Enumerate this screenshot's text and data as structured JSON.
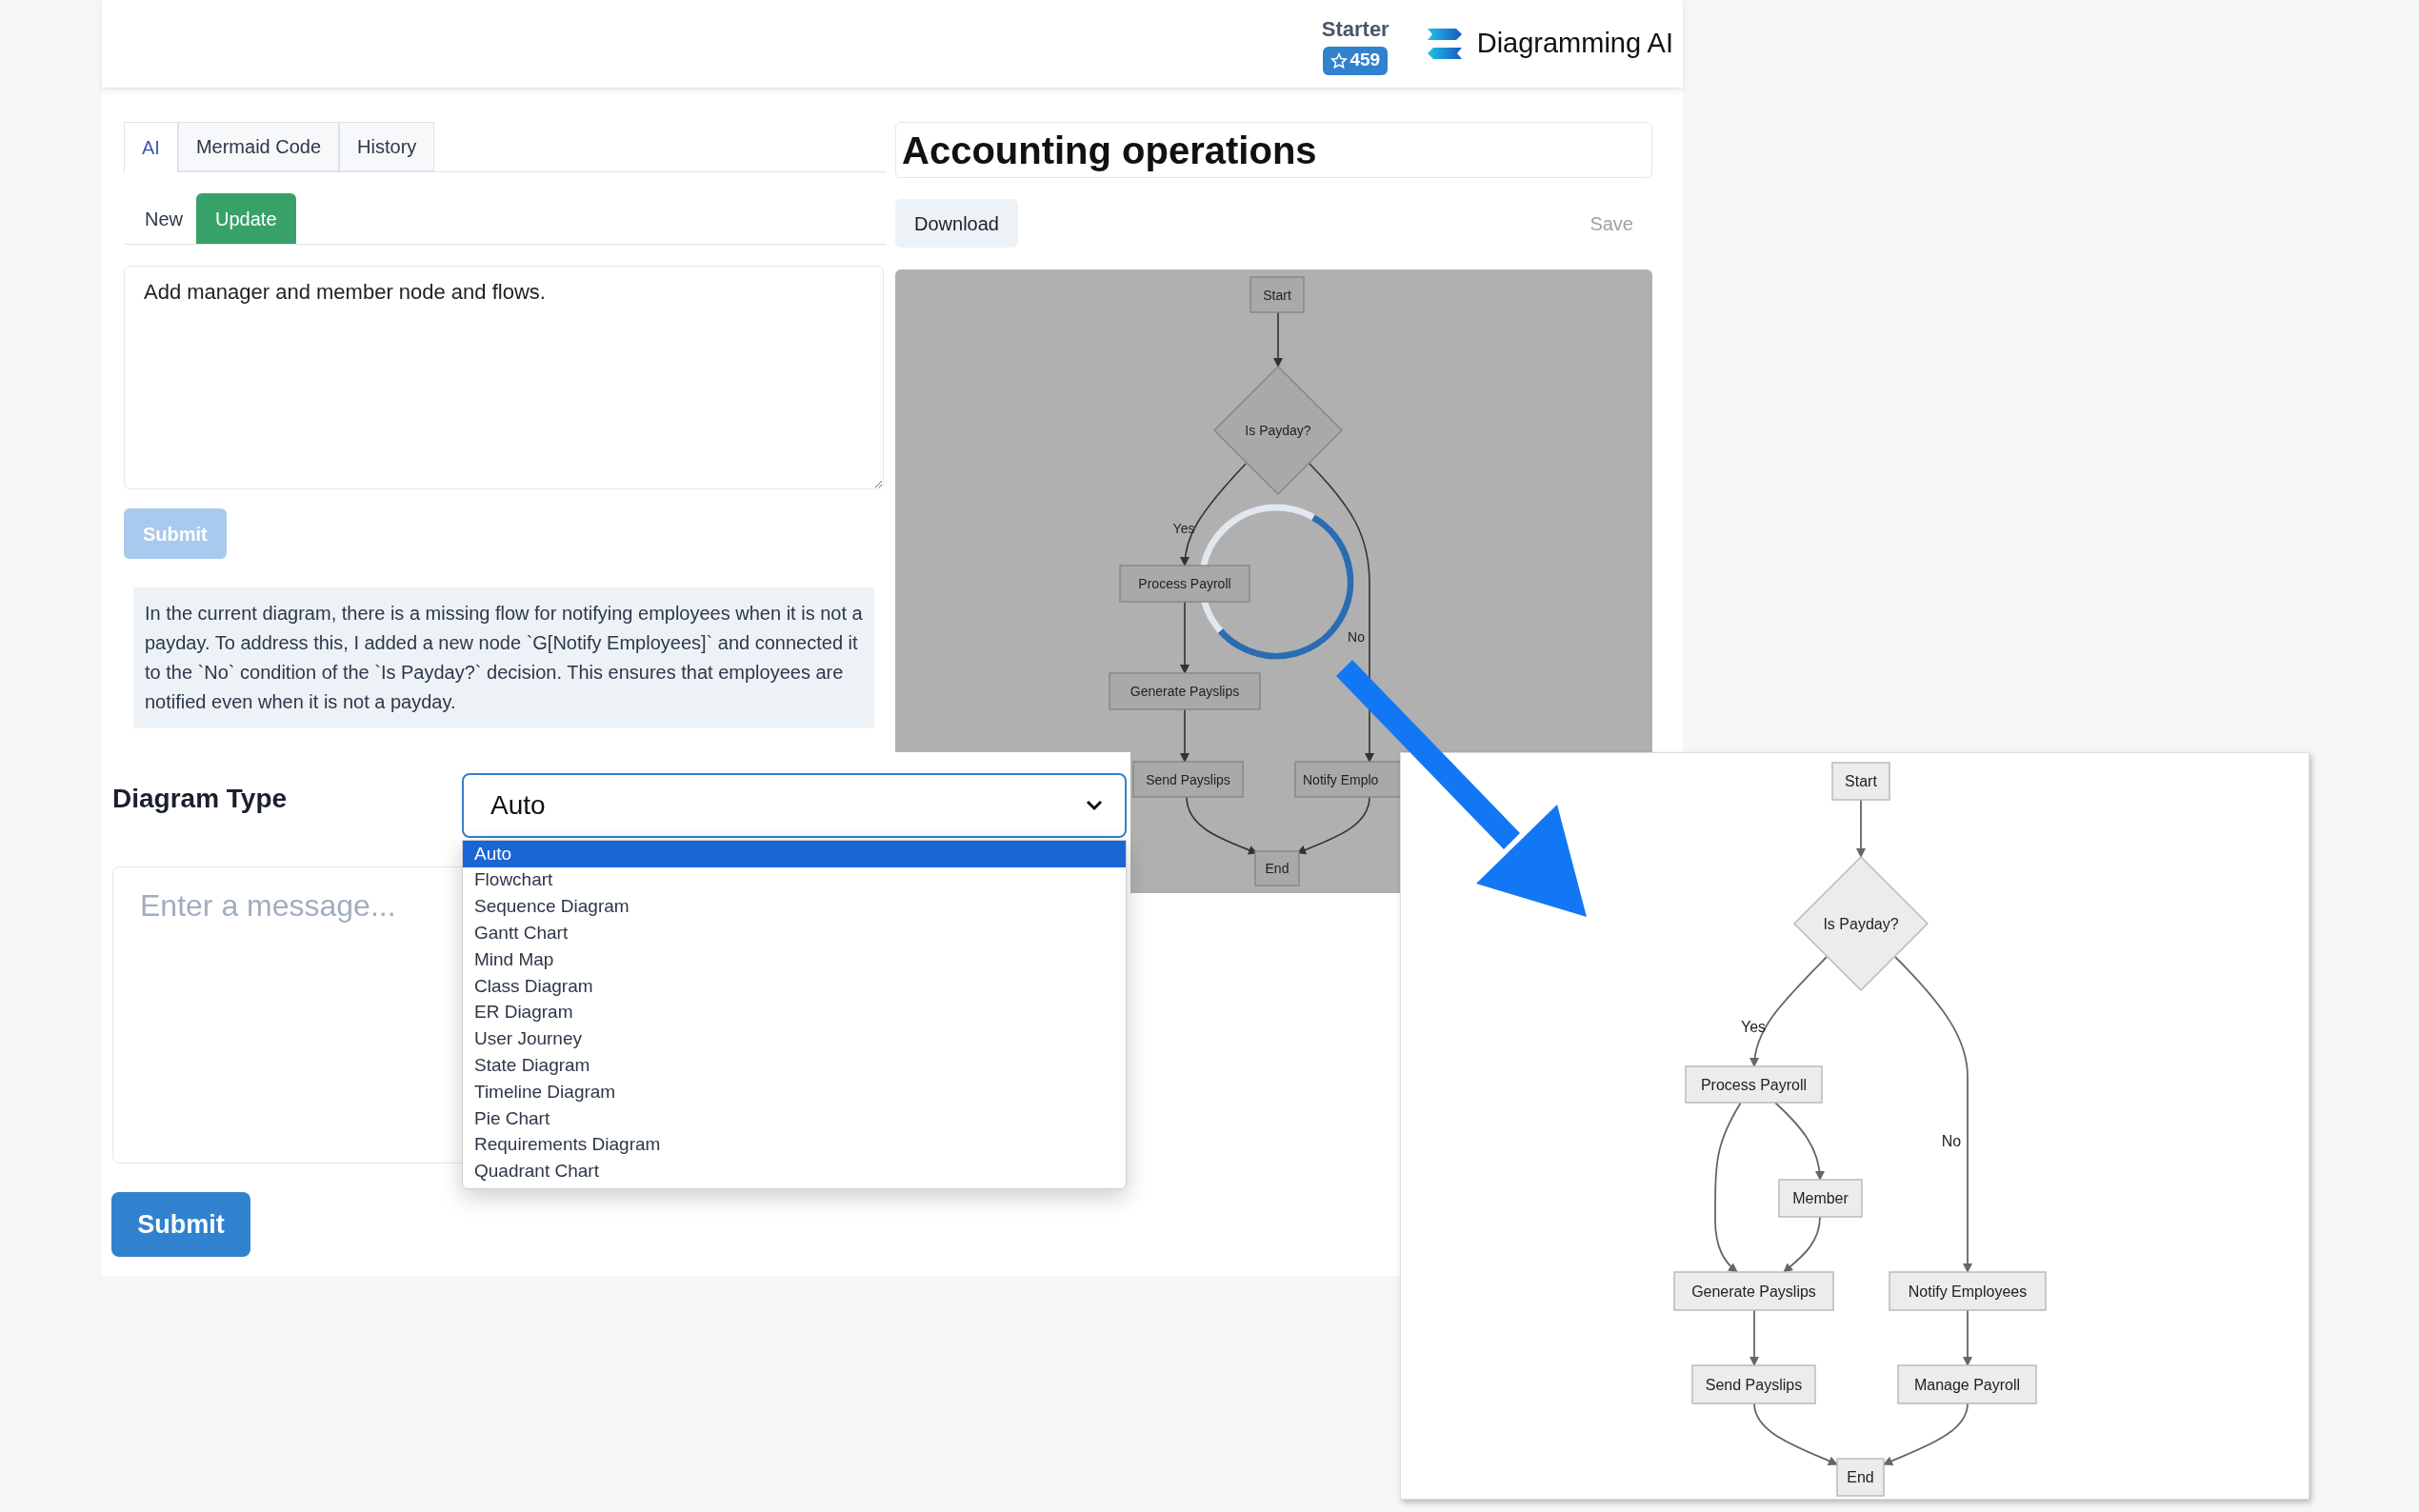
{
  "header": {
    "plan": "Starter",
    "stars_badge": "459",
    "brand": "Diagramming AI"
  },
  "tabs": [
    {
      "label": "AI",
      "selected": true
    },
    {
      "label": "Mermaid Code",
      "selected": false
    },
    {
      "label": "History",
      "selected": false
    }
  ],
  "mode_tabs": [
    {
      "label": "New",
      "selected": false
    },
    {
      "label": "Update",
      "selected": true
    }
  ],
  "prompt": {
    "value": "Add manager and member node and flows."
  },
  "prompt_submit": {
    "label": "Submit",
    "disabled": true
  },
  "explanation": "In the current diagram, there is a missing flow for notifying employees when it is not a payday. To address this, I added a new node `G[Notify Employees]` and connected it to the `No` condition of the `Is Payday?` decision. This ensures that employees are notified even when it is not a payday.",
  "diagram": {
    "title": "Accounting operations",
    "download": "Download",
    "save": {
      "label": "Save",
      "disabled": true
    },
    "loading": true,
    "nodes": [
      {
        "kind": "terminal",
        "label": "Start"
      },
      {
        "kind": "decision",
        "label": "Is Payday?"
      },
      {
        "kind": "process",
        "label": "Process Payroll"
      },
      {
        "kind": "process",
        "label": "Generate Payslips"
      },
      {
        "kind": "process",
        "label": "Send Payslips"
      },
      {
        "kind": "process",
        "label": "Notify Emplo"
      },
      {
        "kind": "terminal",
        "label": "End"
      }
    ],
    "edge_labels": [
      "Yes",
      "No"
    ]
  },
  "diagram_type": {
    "label": "Diagram Type",
    "value": "Auto",
    "expanded": true,
    "options": [
      {
        "label": "Auto",
        "selected": true
      },
      {
        "label": "Flowchart",
        "selected": false
      },
      {
        "label": "Sequence Diagram",
        "selected": false
      },
      {
        "label": "Gantt Chart",
        "selected": false
      },
      {
        "label": "Mind Map",
        "selected": false
      },
      {
        "label": "Class Diagram",
        "selected": false
      },
      {
        "label": "ER Diagram",
        "selected": false
      },
      {
        "label": "User Journey",
        "selected": false
      },
      {
        "label": "State Diagram",
        "selected": false
      },
      {
        "label": "Timeline Diagram",
        "selected": false
      },
      {
        "label": "Pie Chart",
        "selected": false
      },
      {
        "label": "Requirements Diagram",
        "selected": false
      },
      {
        "label": "Quadrant Chart",
        "selected": false
      }
    ]
  },
  "message": {
    "placeholder": "Enter a message..."
  },
  "submit": {
    "label": "Submit",
    "disabled": false
  },
  "result_diagram": {
    "nodes": [
      {
        "kind": "terminal",
        "label": "Start"
      },
      {
        "kind": "decision",
        "label": "Is Payday?"
      },
      {
        "kind": "process",
        "label": "Process Payroll"
      },
      {
        "kind": "process",
        "label": "Member"
      },
      {
        "kind": "process",
        "label": "Generate Payslips"
      },
      {
        "kind": "process",
        "label": "Notify Employees"
      },
      {
        "kind": "process",
        "label": "Send Payslips"
      },
      {
        "kind": "process",
        "label": "Manage Payroll"
      },
      {
        "kind": "terminal",
        "label": "End"
      }
    ],
    "edge_labels": [
      "Yes",
      "No"
    ]
  }
}
